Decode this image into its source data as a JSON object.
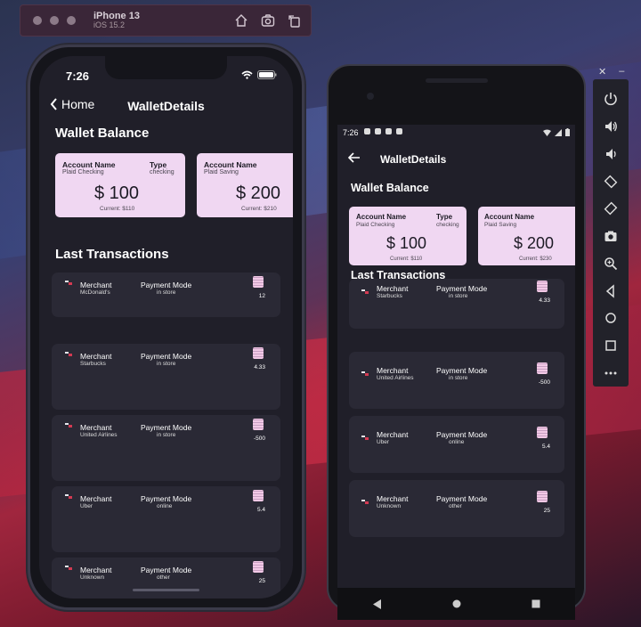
{
  "simulator": {
    "device": "iPhone 13",
    "os": "iOS 15.2"
  },
  "ios": {
    "time": "7:26",
    "back_label": "Home",
    "title": "WalletDetails",
    "balance_heading": "Wallet Balance",
    "last_heading": "Last Transactions",
    "accounts": [
      {
        "name_label": "Account Name",
        "name_value": "Plaid Checking",
        "type_label": "Type",
        "type_value": "checking",
        "amount": "$ 100",
        "current": "Current: $110"
      },
      {
        "name_label": "Account Name",
        "name_value": "Plaid Saving",
        "amount": "$ 200",
        "current": "Current: $210"
      }
    ],
    "transactions": [
      {
        "merchant_label": "Merchant",
        "merchant": "McDonald's",
        "mode_label": "Payment Mode",
        "mode": "in store",
        "amount": "12"
      },
      {
        "merchant_label": "Merchant",
        "merchant": "Starbucks",
        "mode_label": "Payment Mode",
        "mode": "in store",
        "amount": "4.33"
      },
      {
        "merchant_label": "Merchant",
        "merchant": "United Airlines",
        "mode_label": "Payment Mode",
        "mode": "in store",
        "amount": "-500"
      },
      {
        "merchant_label": "Merchant",
        "merchant": "Uber",
        "mode_label": "Payment Mode",
        "mode": "online",
        "amount": "5.4"
      },
      {
        "merchant_label": "Merchant",
        "merchant": "Unknown",
        "mode_label": "Payment Mode",
        "mode": "other",
        "amount": "25"
      }
    ]
  },
  "android": {
    "time": "7:26",
    "title": "WalletDetails",
    "balance_heading": "Wallet Balance",
    "last_heading": "Last Transactions",
    "accounts": [
      {
        "name_label": "Account Name",
        "name_value": "Plaid Checking",
        "type_label": "Type",
        "type_value": "checking",
        "amount": "$ 100",
        "current": "Current: $110"
      },
      {
        "name_label": "Account Name",
        "name_value": "Plaid Saving",
        "amount": "$ 200",
        "current": "Current: $230"
      }
    ],
    "transactions": [
      {
        "merchant_label": "Merchant",
        "merchant": "Starbucks",
        "mode_label": "Payment Mode",
        "mode": "in store",
        "amount": "4.33"
      },
      {
        "merchant_label": "Merchant",
        "merchant": "United Airlines",
        "mode_label": "Payment Mode",
        "mode": "in store",
        "amount": "-500"
      },
      {
        "merchant_label": "Merchant",
        "merchant": "Uber",
        "mode_label": "Payment Mode",
        "mode": "online",
        "amount": "5.4"
      },
      {
        "merchant_label": "Merchant",
        "merchant": "Unknown",
        "mode_label": "Payment Mode",
        "mode": "other",
        "amount": "25"
      }
    ]
  },
  "emulator": {
    "buttons": [
      "power-icon",
      "volume-up-icon",
      "volume-down-icon",
      "rotate-left-icon",
      "rotate-right-icon",
      "camera-icon",
      "zoom-icon",
      "back-icon",
      "home-icon",
      "overview-icon",
      "more-icon"
    ]
  },
  "colors": {
    "card": "#f0d7f2",
    "screen_bg": "#201f29",
    "tile_bg": "#2a2935"
  }
}
